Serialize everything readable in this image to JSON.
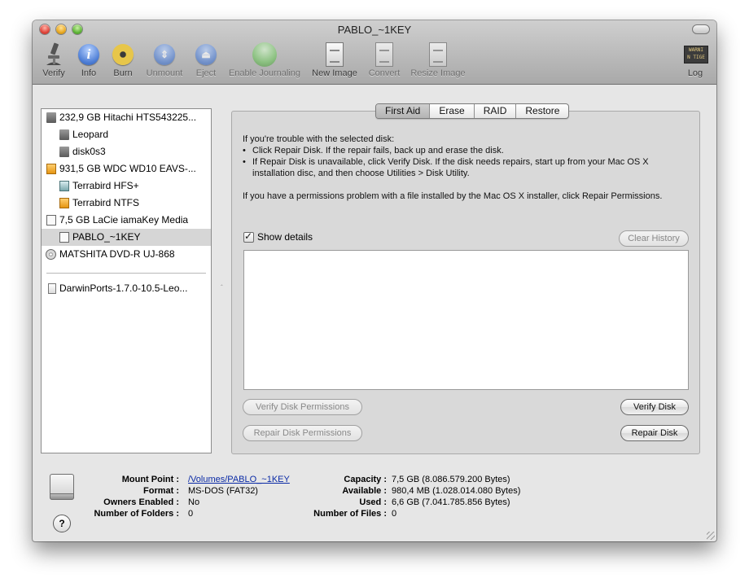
{
  "window": {
    "title": "PABLO_~1KEY"
  },
  "toolbar": {
    "verify": "Verify",
    "info": "Info",
    "burn": "Burn",
    "unmount": "Unmount",
    "eject": "Eject",
    "enable_journaling": "Enable Journaling",
    "new_image": "New Image",
    "convert": "Convert",
    "resize_image": "Resize Image",
    "log": "Log",
    "log_icon_text": "WARNI\nN TIGE"
  },
  "sidebar": {
    "items": [
      {
        "label": "232,9 GB Hitachi HTS543225...",
        "icon": "hard-disk-icon"
      },
      {
        "label": "Leopard",
        "icon": "volume-icon"
      },
      {
        "label": "disk0s3",
        "icon": "volume-icon"
      },
      {
        "label": "931,5 GB WDC WD10 EAVS-...",
        "icon": "external-disk-icon"
      },
      {
        "label": "Terrabird HFS+",
        "icon": "time-machine-volume-icon"
      },
      {
        "label": "Terrabird NTFS",
        "icon": "external-volume-icon"
      },
      {
        "label": "7,5 GB LaCie iamaKey Media",
        "icon": "usb-disk-icon"
      },
      {
        "label": "PABLO_~1KEY",
        "icon": "usb-volume-icon"
      },
      {
        "label": "MATSHITA DVD-R UJ-868",
        "icon": "dvd-drive-icon"
      },
      {
        "label": "DarwinPorts-1.7.0-10.5-Leo...",
        "icon": "disk-image-icon"
      }
    ]
  },
  "tabs": [
    "First Aid",
    "Erase",
    "RAID",
    "Restore"
  ],
  "first_aid": {
    "intro": "If you're trouble with the selected disk:",
    "bullet1": "Click Repair Disk. If the repair fails, back up and erase the disk.",
    "bullet2": "If Repair Disk is unavailable, click Verify Disk. If the disk needs repairs, start up from your Mac OS X installation disc, and then choose Utilities > Disk Utility.",
    "permissions_note": "If you have a permissions problem with a file installed by the Mac OS X installer, click Repair Permissions.",
    "show_details": "Show details",
    "clear_history": "Clear History",
    "verify_permissions": "Verify Disk Permissions",
    "repair_permissions": "Repair Disk Permissions",
    "verify_disk": "Verify Disk",
    "repair_disk": "Repair Disk"
  },
  "info": {
    "mount_point_label": "Mount Point :",
    "mount_point": "/Volumes/PABLO_~1KEY",
    "format_label": "Format :",
    "format": "MS-DOS (FAT32)",
    "owners_label": "Owners Enabled :",
    "owners": "No",
    "folders_label": "Number of Folders :",
    "folders": "0",
    "capacity_label": "Capacity :",
    "capacity": "7,5 GB (8.086.579.200 Bytes)",
    "available_label": "Available :",
    "available": "980,4 MB (1.028.014.080 Bytes)",
    "used_label": "Used :",
    "used": "6,6 GB (7.041.785.856 Bytes)",
    "files_label": "Number of Files :",
    "files": "0",
    "help_glyph": "?"
  }
}
